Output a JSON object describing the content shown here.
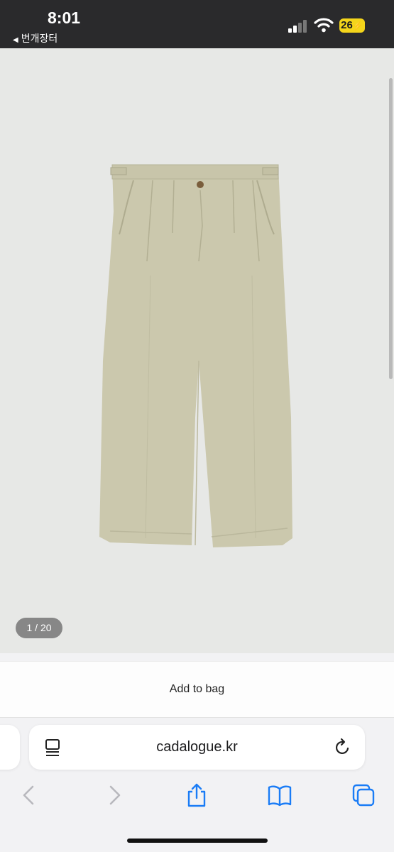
{
  "status_bar": {
    "time": "8:01",
    "back_app": "번개장터",
    "battery": "26"
  },
  "product_image": {
    "description_icon": "khaki-pleated-trousers-photo",
    "counter": "1 / 20"
  },
  "actions": {
    "add_to_bag": "Add to bag"
  },
  "address_bar": {
    "url": "cadalogue.kr"
  },
  "toolbar": {
    "back": "chevron-left-icon",
    "forward": "chevron-right-icon",
    "share": "share-icon",
    "bookmarks": "book-icon",
    "tabs": "tabs-icon"
  },
  "colors": {
    "status_bg": "#2a2a2c",
    "battery": "#f4d51b",
    "accent": "#1a7cf6",
    "trousers": "#cbc8ad",
    "photo_bg": "#e7e8e6"
  }
}
